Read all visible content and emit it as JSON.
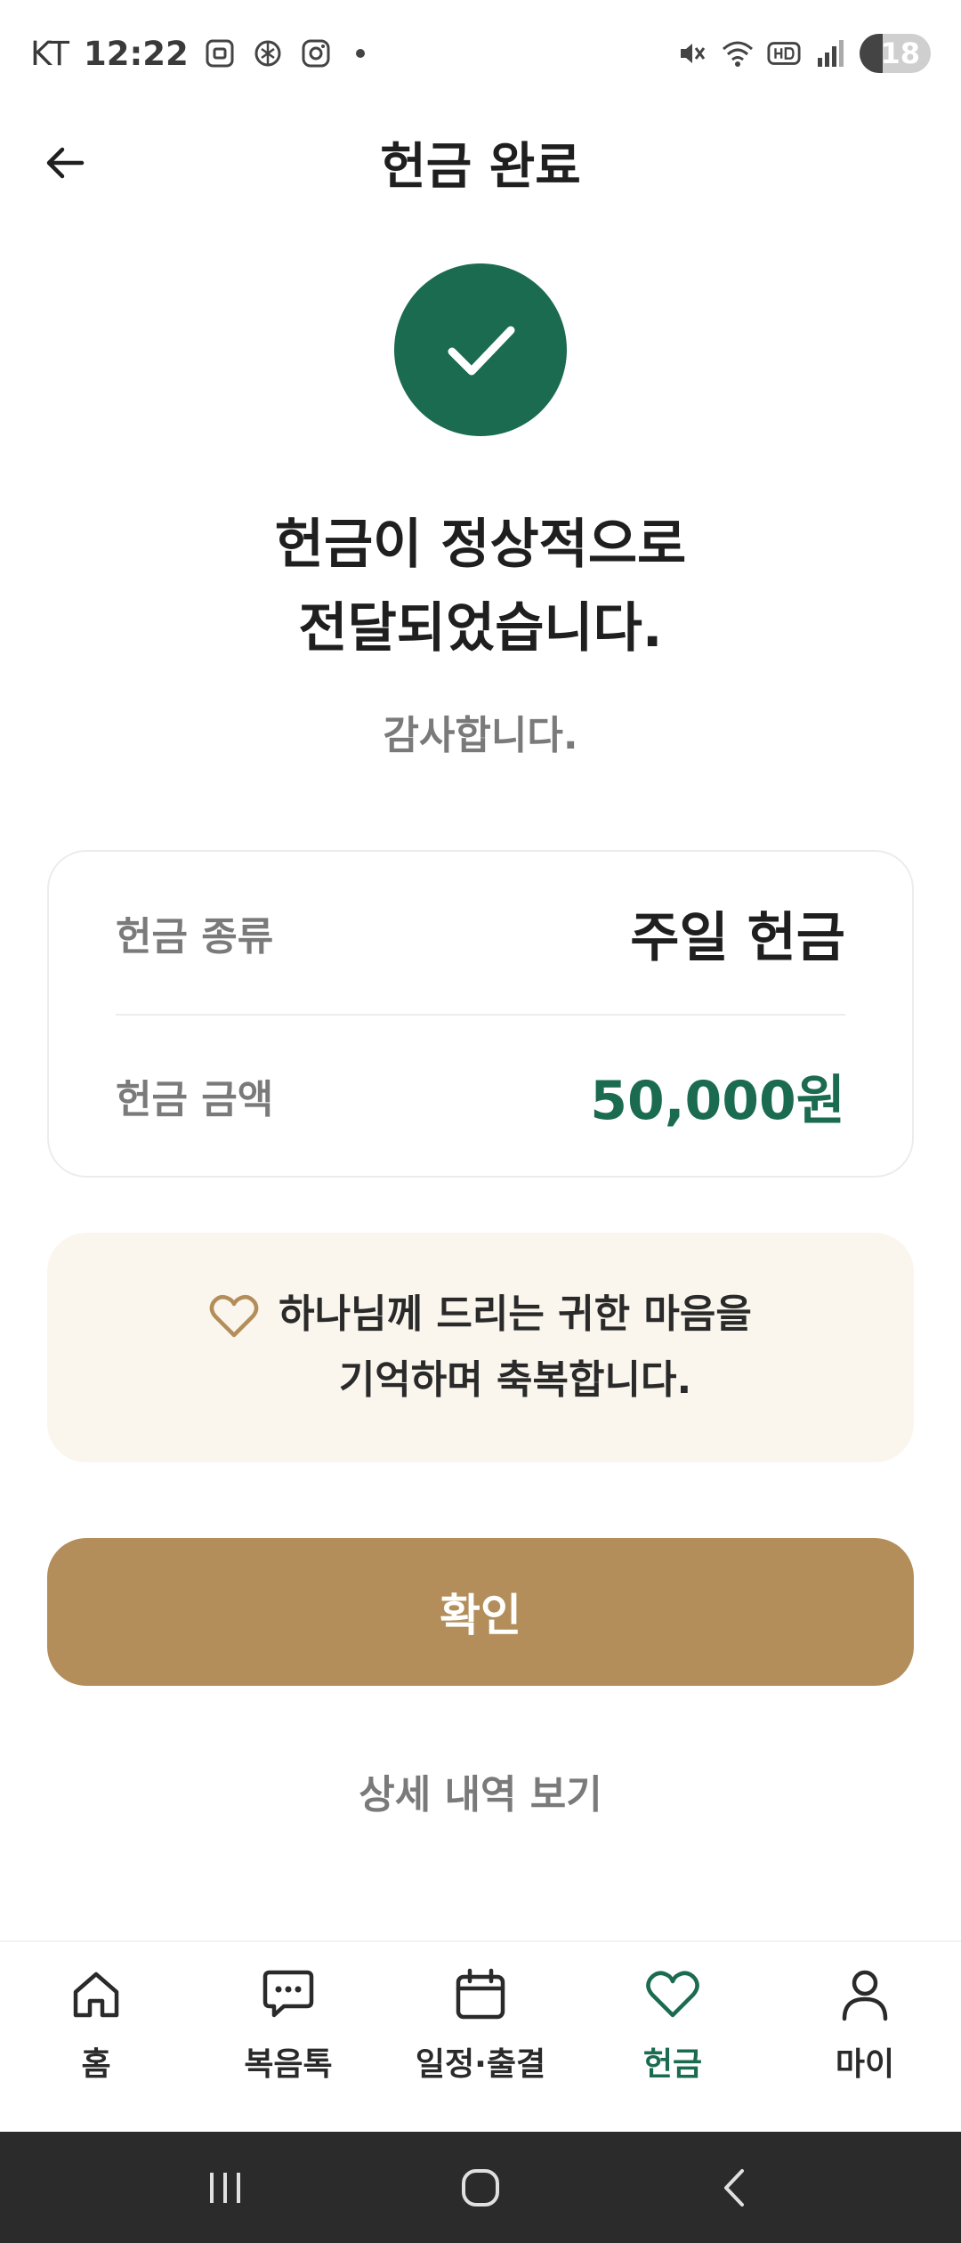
{
  "status_bar": {
    "carrier": "KT",
    "time": "12:22",
    "battery": "18"
  },
  "header": {
    "title": "헌금 완료"
  },
  "success": {
    "headline_line1": "헌금이 정상적으로",
    "headline_line2": "전달되었습니다.",
    "subtext": "감사합니다."
  },
  "info": {
    "rows": [
      {
        "label": "헌금 종류",
        "value": "주일 헌금"
      },
      {
        "label": "헌금 금액",
        "value": "50,000원"
      }
    ]
  },
  "blessing": {
    "line1": "하나님께 드리는 귀한 마음을",
    "line2": "기억하며 축복합니다."
  },
  "actions": {
    "confirm_label": "확인",
    "detail_link": "상세 내역 보기"
  },
  "bottom_nav": {
    "items": [
      {
        "label": "홈",
        "icon": "home-icon"
      },
      {
        "label": "복음톡",
        "icon": "chat-icon"
      },
      {
        "label": "일정·출결",
        "icon": "calendar-icon"
      },
      {
        "label": "헌금",
        "icon": "heart-icon",
        "active": true
      },
      {
        "label": "마이",
        "icon": "person-icon"
      }
    ]
  },
  "colors": {
    "primary_green": "#1b6b50",
    "gold": "#b38e5a",
    "cream": "#faf6ee"
  }
}
